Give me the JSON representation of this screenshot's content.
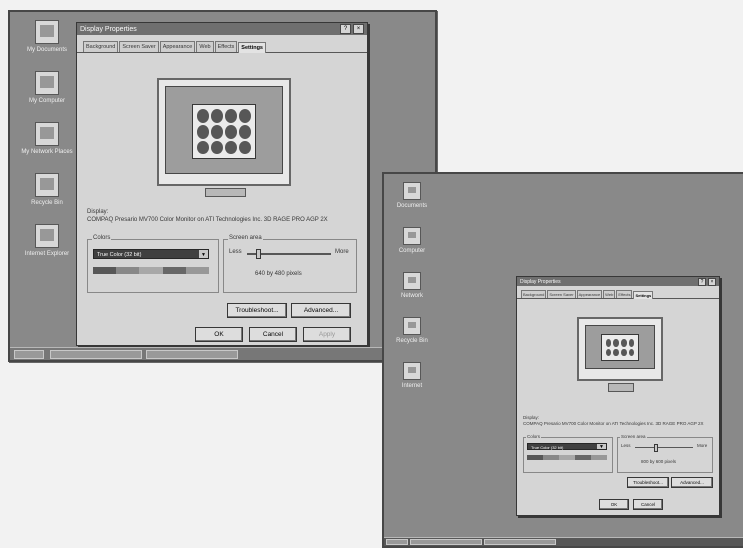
{
  "shot1": {
    "desktop_icons": [
      {
        "label": "My Documents",
        "icon": "folder-icon"
      },
      {
        "label": "My Computer",
        "icon": "computer-icon"
      },
      {
        "label": "My Network Places",
        "icon": "network-icon"
      },
      {
        "label": "Recycle Bin",
        "icon": "recycle-bin-icon"
      },
      {
        "label": "Internet Explorer",
        "icon": "browser-icon"
      }
    ],
    "dialog": {
      "title": "Display Properties",
      "title_help": "?",
      "title_close": "×",
      "tabs": [
        "Background",
        "Screen Saver",
        "Appearance",
        "Web",
        "Effects",
        "Settings"
      ],
      "active_tab": "Settings",
      "display_label": "Display:",
      "display_value": "COMPAQ Presario MV700 Color Monitor on ATI Technologies Inc. 3D RAGE PRO AGP 2X",
      "colors_label": "Colors",
      "colors_value": "True Color (32 bit)",
      "combo_arrow": "▼",
      "screen_area_label": "Screen area",
      "less_label": "Less",
      "more_label": "More",
      "resolution": "640 by 480 pixels",
      "troubleshoot_label": "Troubleshoot...",
      "advanced_label": "Advanced...",
      "ok_label": "OK",
      "cancel_label": "Cancel",
      "apply_label": "Apply",
      "slider_position": 0.12
    }
  },
  "shot2": {
    "desktop_icons": [
      {
        "label": "Documents",
        "icon": "folder-icon"
      },
      {
        "label": "Computer",
        "icon": "computer-icon"
      },
      {
        "label": "Network",
        "icon": "network-icon"
      },
      {
        "label": "Recycle Bin",
        "icon": "recycle-bin-icon"
      },
      {
        "label": "Internet",
        "icon": "browser-icon"
      }
    ],
    "dialog": {
      "title": "Display Properties",
      "title_help": "?",
      "title_close": "×",
      "tabs": [
        "Background",
        "Screen Saver",
        "Appearance",
        "Web",
        "Effects",
        "Settings"
      ],
      "active_tab": "Settings",
      "display_label": "Display:",
      "display_value": "COMPAQ Presario MV700 Color Monitor on ATI Technologies Inc. 3D RAGE PRO AGP 2X",
      "colors_label": "Colors",
      "colors_value": "True Color (32 bit)",
      "combo_arrow": "▼",
      "screen_area_label": "Screen area",
      "less_label": "Less",
      "more_label": "More",
      "resolution": "800 by 600 pixels",
      "troubleshoot_label": "Troubleshoot...",
      "advanced_label": "Advanced...",
      "ok_label": "OK",
      "cancel_label": "Cancel",
      "slider_position": 0.35
    }
  }
}
